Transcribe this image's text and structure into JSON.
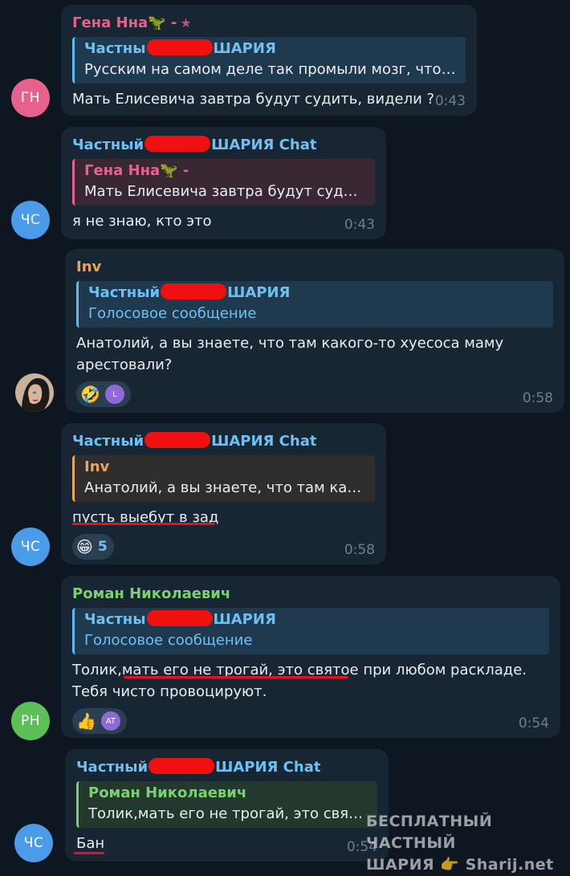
{
  "messages": [
    {
      "avatar": "ГН",
      "sender_name": "Гена Нна",
      "sender_emoji": "🦖",
      "sender_suffix": "-",
      "reply_name_left": "Частны",
      "reply_name_right": "ШАРИЯ",
      "reply_text": "Русским на самом деле так промыли мозг, что ...",
      "text": "Мать Елисевича завтра будут судить, видели ?",
      "time": "0:43"
    },
    {
      "avatar": "ЧС",
      "sender_left": "Частный",
      "sender_right": "ШАРИЯ Chat",
      "reply_name": "Гена Нна",
      "reply_emoji": "🦖",
      "reply_suffix": "-",
      "reply_text": "Мать Елисевича завтра будут судит...",
      "text": "я не знаю, кто это",
      "time": "0:43"
    },
    {
      "avatar_icon": "user-photo",
      "sender_name": "Inv",
      "reply_name_left": "Частный",
      "reply_name_right": "ШАРИЯ",
      "reply_text": "Голосовое сообщение",
      "text_line1": "Анатолий, а вы знаете, что там какого-то хуесоса маму",
      "text_line2": "арестовали?",
      "reaction_emoji": "🤣",
      "reaction_user": "L",
      "time": "0:58"
    },
    {
      "avatar": "ЧС",
      "sender_left": "Частный",
      "sender_right": "ШАРИЯ Chat",
      "reply_name": "Inv",
      "reply_text": "Анатолий, а вы знаете, что там как...",
      "text": "пусть выебут в зад",
      "reaction_emoji": "😁",
      "reaction_count": "5",
      "time": "0:58"
    },
    {
      "avatar": "РН",
      "sender_name": "Роман Николаевич",
      "reply_name_left": "Частны",
      "reply_name_right": "ШАРИЯ",
      "reply_text": "Голосовое сообщение",
      "text_a": "Толик,",
      "text_b": "мать его не трогай, это святое",
      "text_c": " при любом раскладе.",
      "text_line2": "Тебя чисто провоцируют.",
      "reaction_emoji": "👍",
      "reaction_user": "AT",
      "time": "0:54"
    },
    {
      "avatar": "ЧС",
      "sender_left": "Частный",
      "sender_right": "ШАРИЯ Chat",
      "reply_name": "Роман Николаевич",
      "reply_text": "Толик,мать его не трогай, это свято...",
      "text": "Бан",
      "time": "0:54"
    }
  ],
  "watermark": {
    "line1": "БЕСПЛАТНЫЙ ЧАСТНЫЙ",
    "line2_left": "ШАРИЯ",
    "line2_icon": "👉",
    "line2_right": "Sharij.net"
  },
  "colors": {
    "background": "#0e1621",
    "bubble": "#182533",
    "name_blue": "#6fc0f2",
    "name_pink": "#e8618c",
    "name_orange": "#e8a65a",
    "name_green": "#7ccf74",
    "redaction": "#f01010",
    "underline": "#e3102a"
  }
}
